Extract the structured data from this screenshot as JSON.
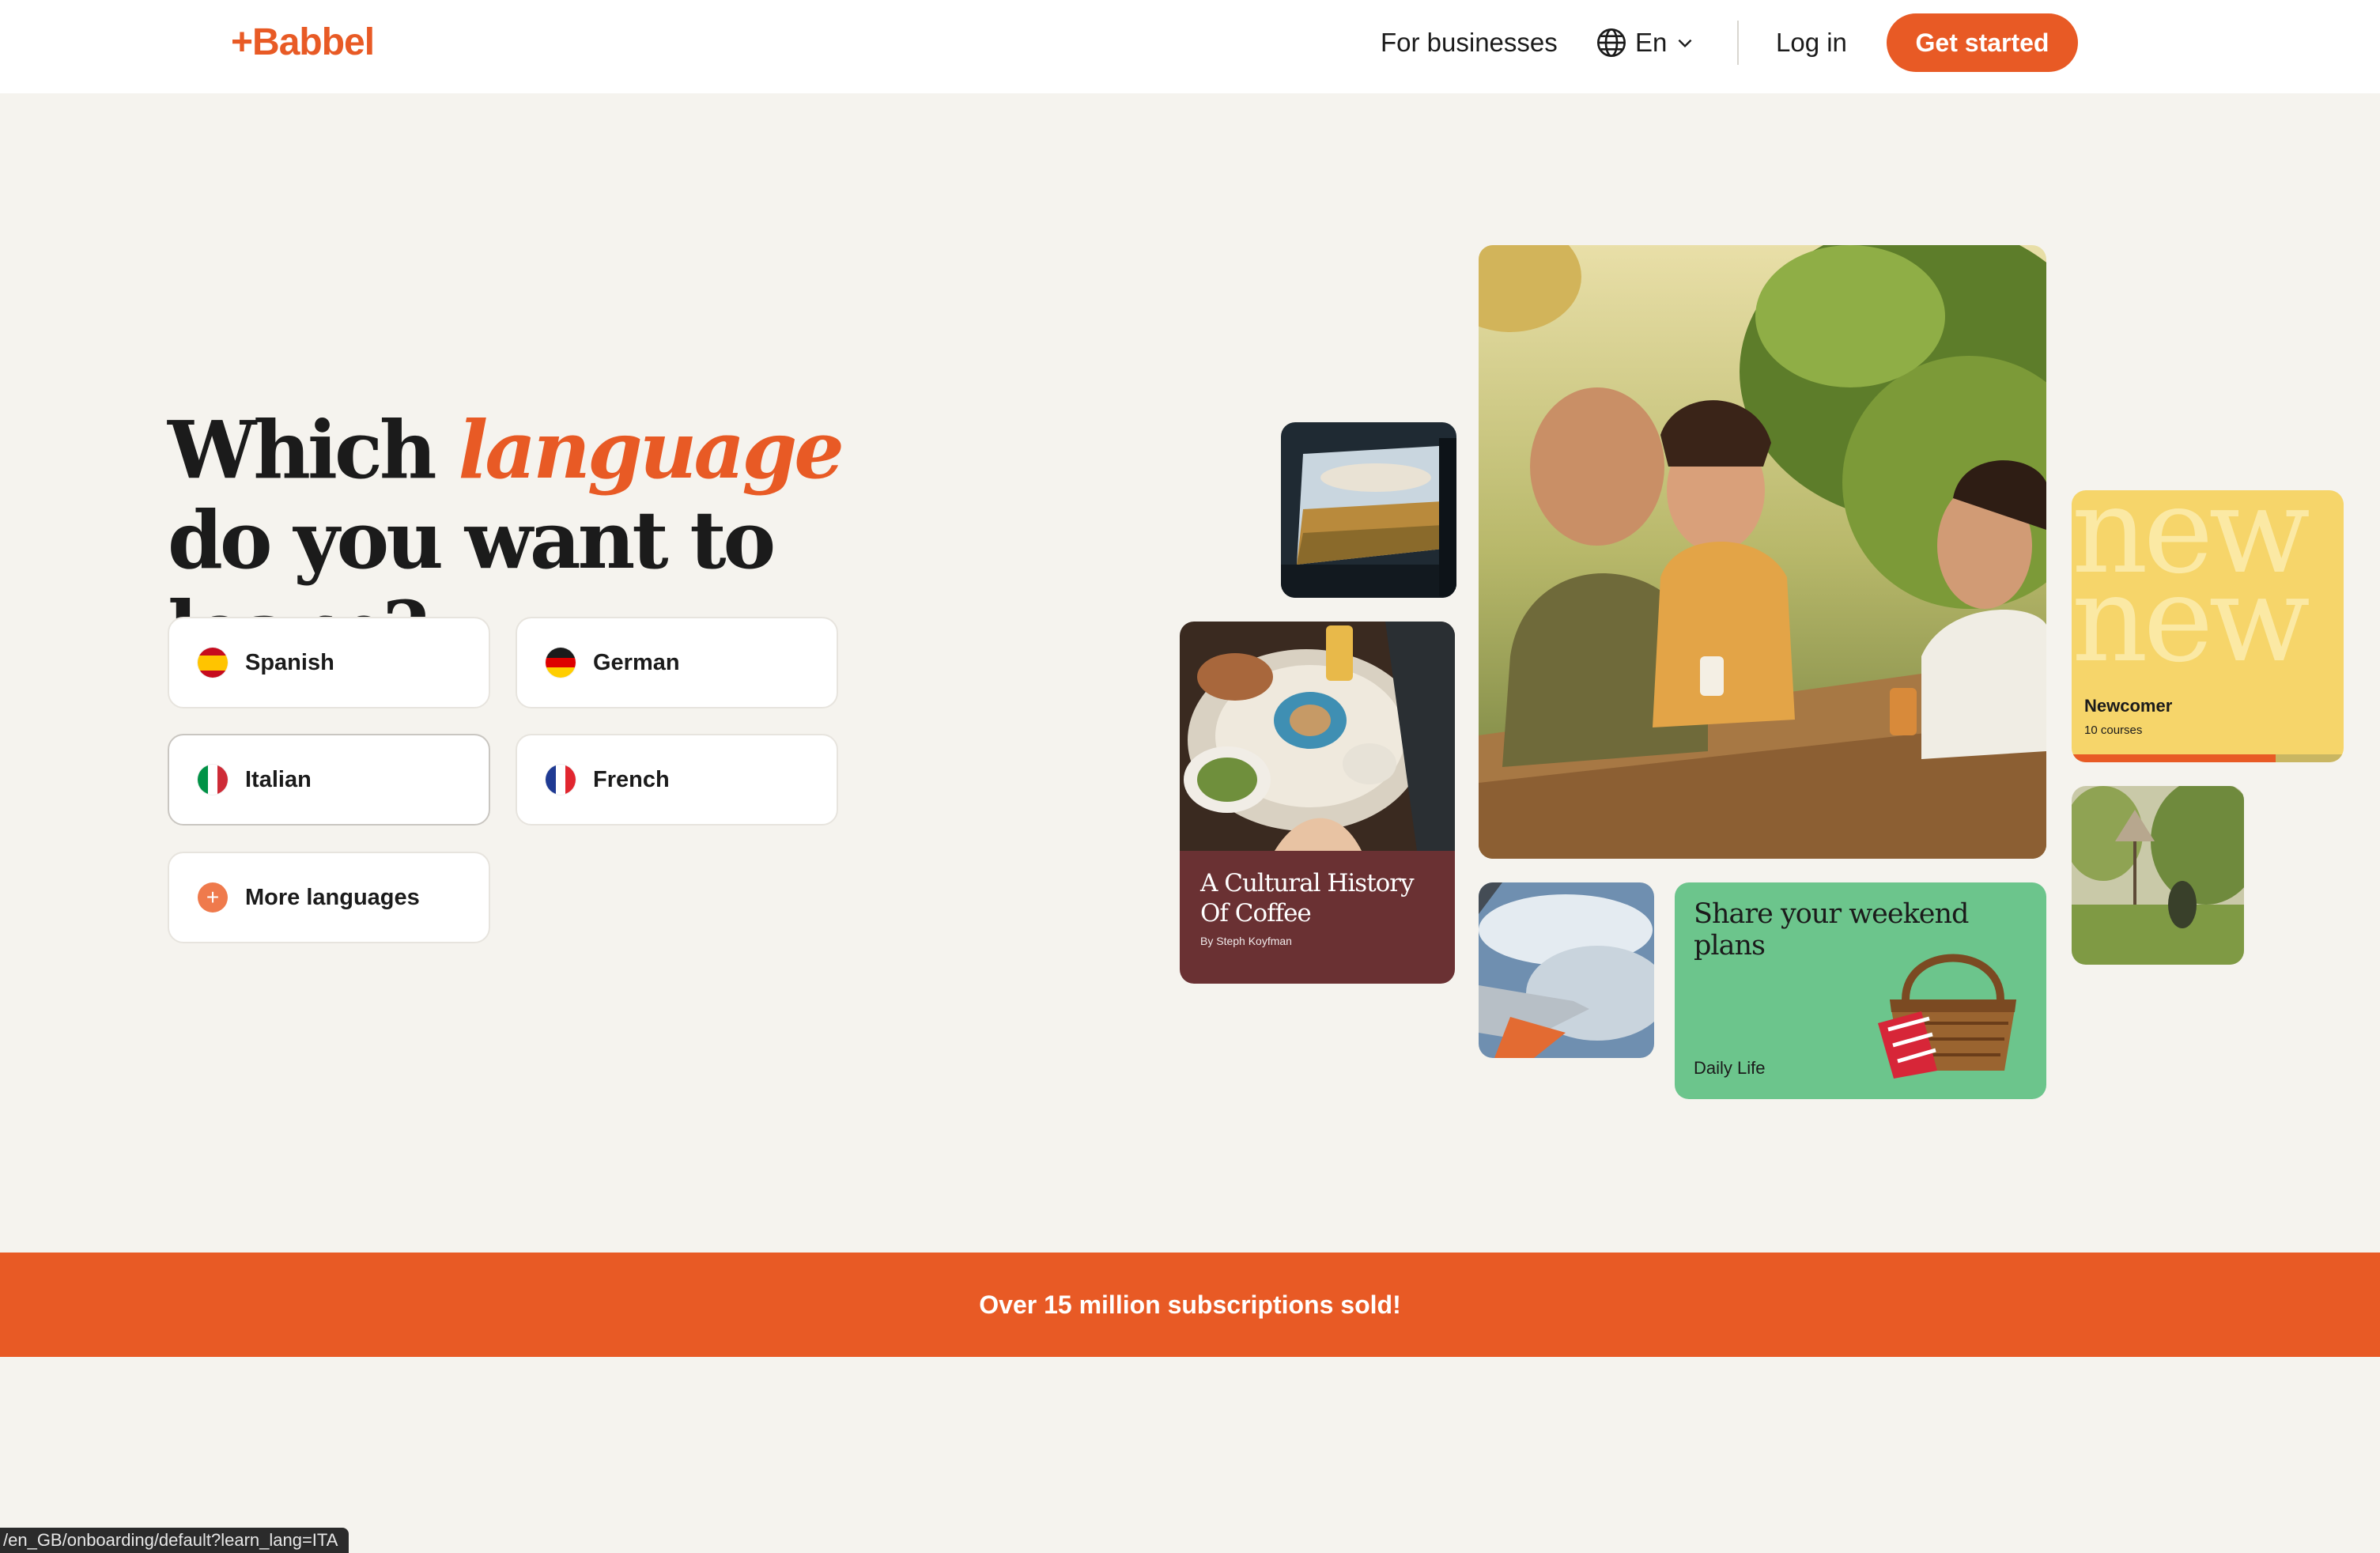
{
  "header": {
    "logo": "+Babbel",
    "for_businesses": "For businesses",
    "language_selector": "En",
    "log_in": "Log in",
    "get_started": "Get started"
  },
  "hero": {
    "headline_part1": "Which ",
    "headline_accent": "language",
    "headline_part2": " do you want to learn?",
    "languages": [
      {
        "label": "Spanish",
        "flag": "spain-flag-icon"
      },
      {
        "label": "German",
        "flag": "germany-flag-icon"
      },
      {
        "label": "Italian",
        "flag": "italy-flag-icon"
      },
      {
        "label": "French",
        "flag": "france-flag-icon"
      }
    ],
    "more_languages": "More languages"
  },
  "collage": {
    "coffee_title": "A Cultural History Of Coffee",
    "coffee_author": "By Steph Koyfman",
    "weekend_title": "Share your weekend plans",
    "weekend_category": "Daily Life",
    "newcomer_bg_text": "new",
    "newcomer_title": "Newcomer",
    "newcomer_courses": "10 courses",
    "newcomer_progress": 0.75
  },
  "banner": {
    "text": "Over 15 million subscriptions sold!"
  },
  "status_url": "/en_GB/onboarding/default?learn_lang=ITA",
  "colors": {
    "brand": "#e85a25",
    "background": "#f5f3ee",
    "coffee_card": "#6a3133",
    "weekend_card": "#6cc58c",
    "newcomer_card": "#f6d56a"
  }
}
